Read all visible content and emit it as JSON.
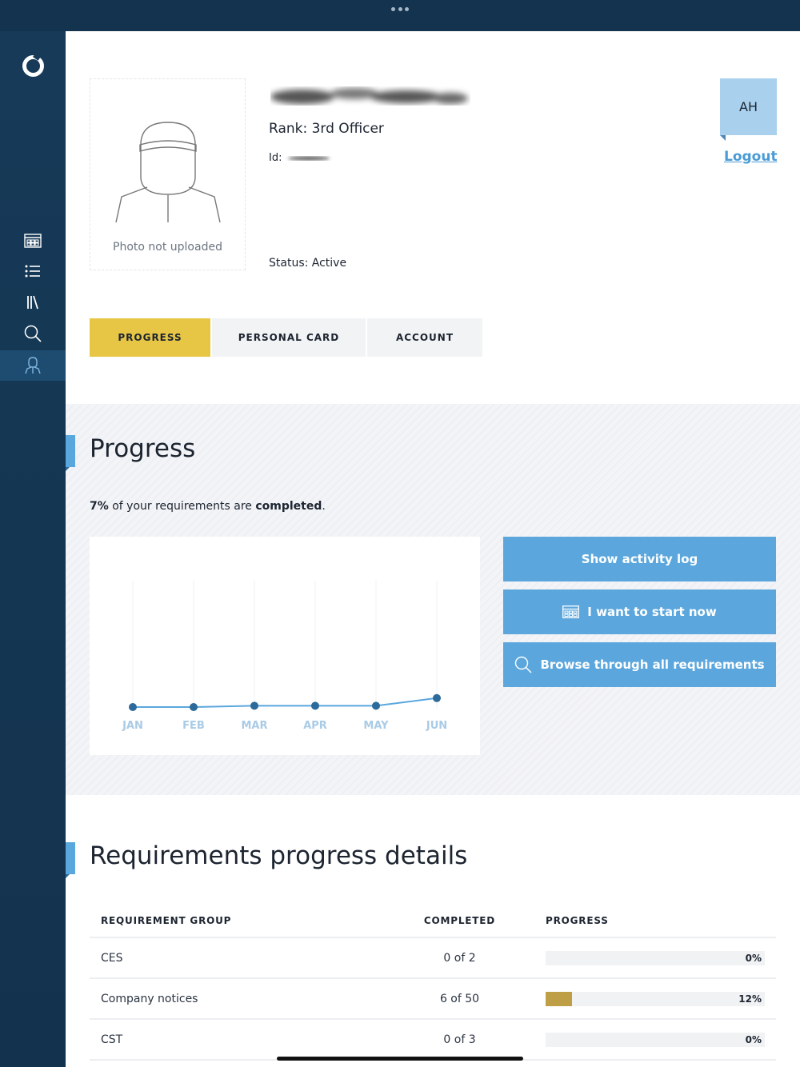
{
  "profile": {
    "photo_caption": "Photo not uploaded",
    "rank": "Rank: 3rd Officer",
    "id_label": "Id:",
    "status": "Status: Active"
  },
  "user": {
    "initials": "AH",
    "logout_label": "Logout"
  },
  "tabs": [
    {
      "label": "PROGRESS",
      "active": true
    },
    {
      "label": "PERSONAL CARD",
      "active": false
    },
    {
      "label": "ACCOUNT",
      "active": false
    }
  ],
  "progress": {
    "title": "Progress",
    "summary_pct": "7%",
    "summary_mid": " of your requirements are ",
    "summary_bold": "completed",
    "summary_end": "."
  },
  "actions": {
    "activity_log": "Show activity log",
    "start_now": "I want to start now",
    "browse": "Browse through all requirements"
  },
  "chart_data": {
    "type": "line",
    "categories": [
      "JAN",
      "FEB",
      "MAR",
      "APR",
      "MAY",
      "JUN"
    ],
    "values": [
      0.0,
      0.0,
      1.0,
      1.0,
      1.0,
      7.0
    ],
    "ylim": [
      0,
      100
    ],
    "grid": "vertical",
    "color": "#2b6a9a",
    "tick_color": "#a9cbe6"
  },
  "details": {
    "title": "Requirements progress details",
    "headers": {
      "group": "REQUIREMENT GROUP",
      "completed": "COMPLETED",
      "progress": "PROGRESS"
    },
    "rows": [
      {
        "group": "CES",
        "completed": "0 of 2",
        "pct_label": "0%",
        "pct": 0
      },
      {
        "group": "Company notices",
        "completed": "6 of 50",
        "pct_label": "12%",
        "pct": 12
      },
      {
        "group": "CST",
        "completed": "0 of 3",
        "pct_label": "0%",
        "pct": 0
      }
    ]
  },
  "colors": {
    "sidebar": "#163a58",
    "active_tab": "#e8c645",
    "accent_blue": "#5ba7dd",
    "progress_fill": "#bf9f45"
  },
  "icons": {
    "nav": [
      "dashboard-icon",
      "list-icon",
      "library-icon",
      "search-icon",
      "profile-icon"
    ]
  }
}
